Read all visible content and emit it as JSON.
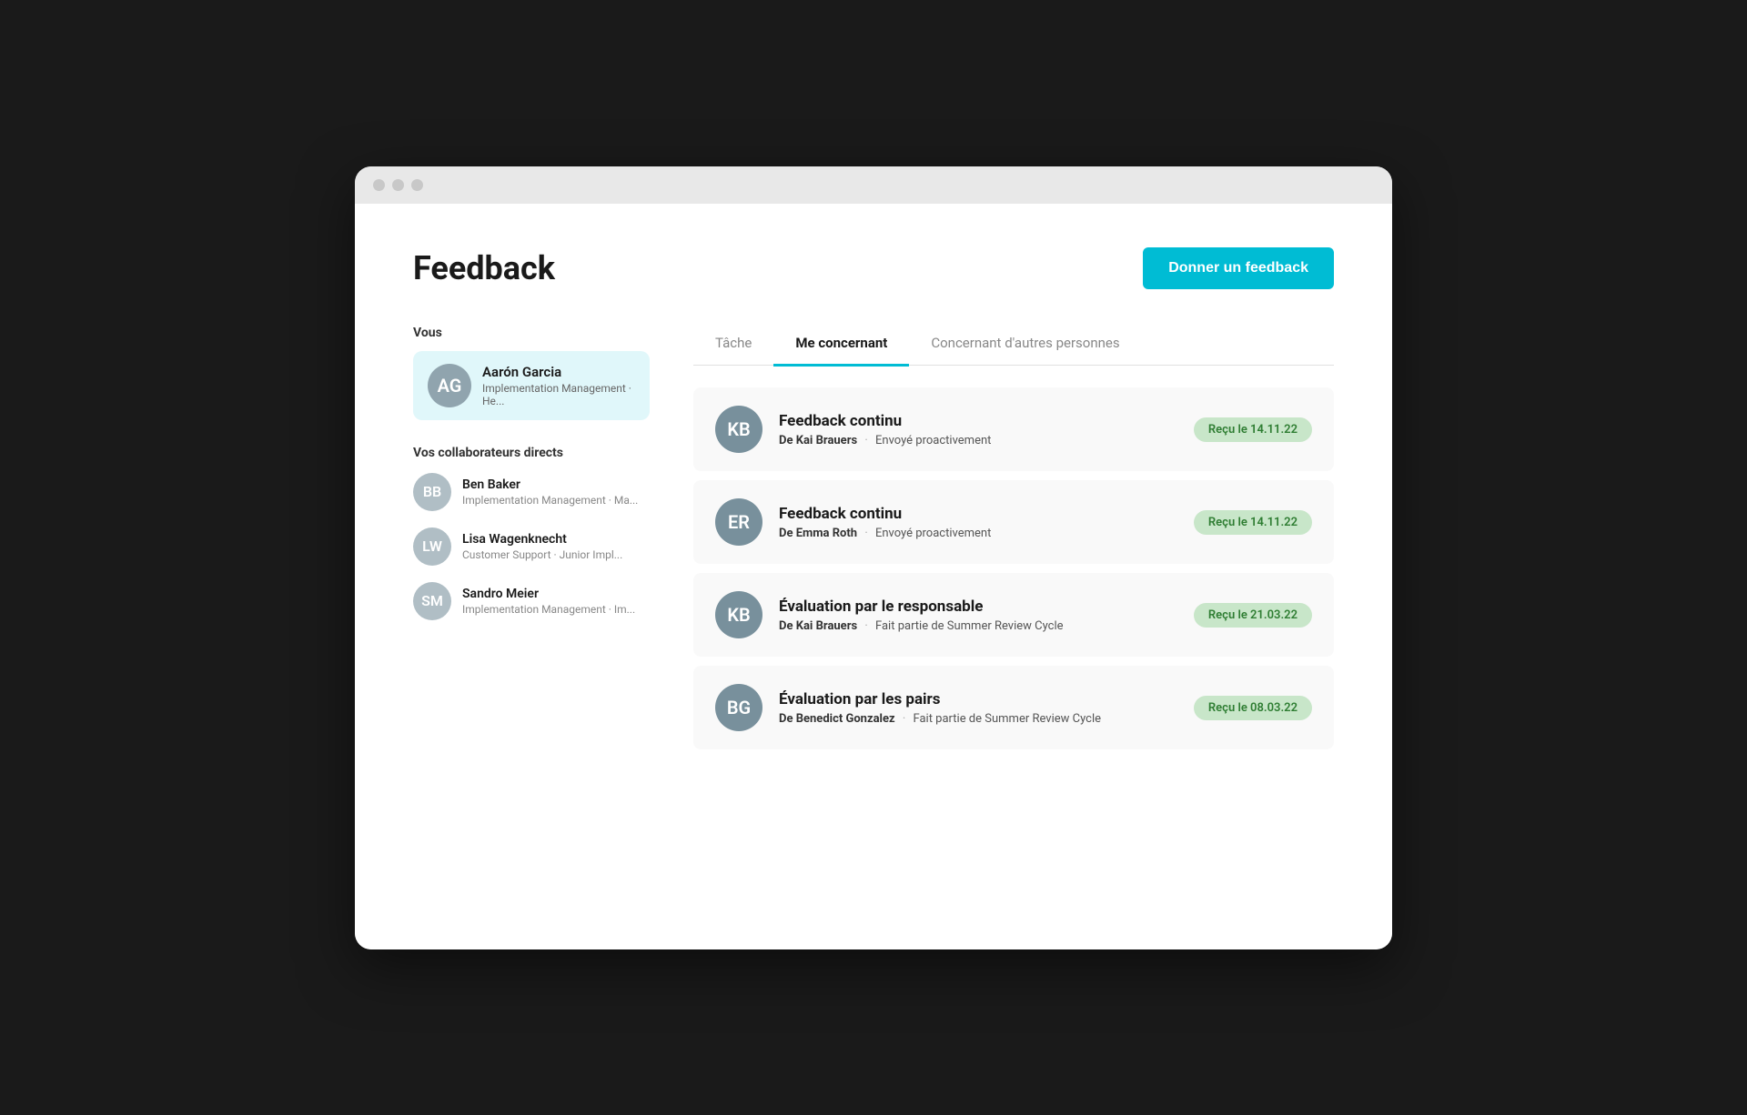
{
  "page": {
    "title": "Feedback",
    "cta_button": "Donner un feedback"
  },
  "sidebar": {
    "you_label": "Vous",
    "selected_user": {
      "name": "Aarón Garcia",
      "role": "Implementation Management · He...",
      "initials": "AG",
      "avatar_class": "av-aaron"
    },
    "collaborators_label": "Vos collaborateurs directs",
    "collaborators": [
      {
        "name": "Ben Baker",
        "role": "Implementation Management · Ma...",
        "initials": "BB",
        "avatar_class": "av-ben"
      },
      {
        "name": "Lisa Wagenknecht",
        "role": "Customer Support · Junior Impl...",
        "initials": "LW",
        "avatar_class": "av-lisa"
      },
      {
        "name": "Sandro Meier",
        "role": "Implementation Management · Im...",
        "initials": "SM",
        "avatar_class": "av-sandro"
      }
    ]
  },
  "tabs": [
    {
      "label": "Tâche",
      "active": false
    },
    {
      "label": "Me concernant",
      "active": true
    },
    {
      "label": "Concernant d'autres personnes",
      "active": false
    }
  ],
  "feedback_items": [
    {
      "type": "Feedback continu",
      "sender": "De Kai Brauers",
      "detail": "Envoyé proactivement",
      "badge": "Reçu le 14.11.22",
      "initials": "KB",
      "avatar_class": "av-kai"
    },
    {
      "type": "Feedback continu",
      "sender": "De Emma Roth",
      "detail": "Envoyé proactivement",
      "badge": "Reçu le 14.11.22",
      "initials": "ER",
      "avatar_class": "av-emma"
    },
    {
      "type": "Évaluation par le responsable",
      "sender": "De Kai Brauers",
      "detail": "Fait partie de Summer Review Cycle",
      "badge": "Reçu le 21.03.22",
      "initials": "KB",
      "avatar_class": "av-kai"
    },
    {
      "type": "Évaluation par les pairs",
      "sender": "De Benedict Gonzalez",
      "detail": "Fait partie de Summer Review Cycle",
      "badge": "Reçu le 08.03.22",
      "initials": "BG",
      "avatar_class": "av-benedict"
    }
  ]
}
